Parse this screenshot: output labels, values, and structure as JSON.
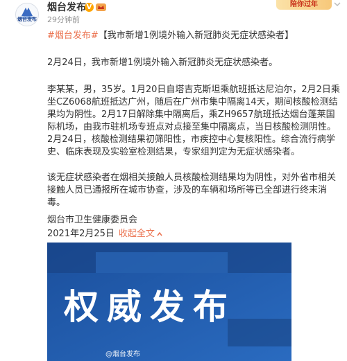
{
  "header": {
    "avatar_text": "烟台发布",
    "username": "烟台发布",
    "timestamp": "29分钟前",
    "promo_text": "陪你过年",
    "verified_mark": "V"
  },
  "post": {
    "hashtag": "#烟台发布#",
    "headline": "【我市新增1例境外输入新冠肺炎无症状感染者】",
    "paragraph1": "2月24日，我市新增1例境外输入新冠肺炎无症状感染者。",
    "paragraph2": "李某某，男，35岁。1月20日自塔吉克斯坦乘航班抵达尼泊尔，2月2日乘坐CZ6068航班抵达广州，随后在广州市集中隔离14天，期间核酸检测结果均为阴性。2月17日解除集中隔离后，乘ZH9657航班抵达烟台蓬莱国际机场，由我市驻机场专班点对点接至集中隔离点，当日核酸检测阴性。2月24日，核酸检测结果初筛阳性，市疾控中心复核阳性。综合流行病学史、临床表现及实验室检测结果，专家组判定为无症状感染者。",
    "paragraph3": "该无症状感染者在烟相关接触人员核酸检测结果均为阴性，对外省市相关接触人员已通报所在城市协查，涉及的车辆和场所等已全部进行终末消毒。",
    "source": "烟台市卫生健康委员会",
    "date": "2021年2月25日",
    "collapse_label": "收起全文"
  },
  "media": {
    "headline_text": "权威发布",
    "watermark": "@烟台发布"
  },
  "colors": {
    "link": "#eb7350",
    "verified": "#ffa500",
    "media_bg": "#1e5aa8"
  }
}
